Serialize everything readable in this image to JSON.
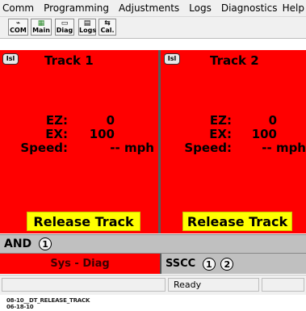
{
  "menu": [
    "Comm",
    "Programming",
    "Adjustments",
    "Logs",
    "Diagnostics",
    "Help"
  ],
  "toolbar": [
    {
      "label": "COM",
      "icon": "com-icon"
    },
    {
      "label": "Main",
      "icon": "main-icon"
    },
    {
      "label": "Diag",
      "icon": "diag-icon"
    },
    {
      "label": "Logs",
      "icon": "logs-icon"
    },
    {
      "label": "Cal.",
      "icon": "cal-icon"
    }
  ],
  "panels": [
    {
      "badge": "Isl",
      "title": "Track 1",
      "ez_label": "EZ:",
      "ez": "0",
      "ex_label": "EX:",
      "ex": "100",
      "speed_label": "Speed:",
      "speed": "-- mph",
      "button": "Release Track"
    },
    {
      "badge": "Isl",
      "title": "Track 2",
      "ez_label": "EZ:",
      "ez": "0",
      "ex_label": "EX:",
      "ex": "100",
      "speed_label": "Speed:",
      "speed": "-- mph",
      "button": "Release Track"
    }
  ],
  "and_bar": {
    "label": "AND",
    "indicator": "1"
  },
  "sys_diag": "Sys - Diag",
  "sscc": {
    "label": "SSCC",
    "indicators": [
      "1",
      "2"
    ]
  },
  "status": {
    "text": "Ready"
  },
  "footer": [
    "08-10__DT_RELEASE_TRACK",
    "06-18-10"
  ],
  "colors": {
    "panel": "#ff0000",
    "release": "#ffff00",
    "bar": "#c0c0c0"
  }
}
